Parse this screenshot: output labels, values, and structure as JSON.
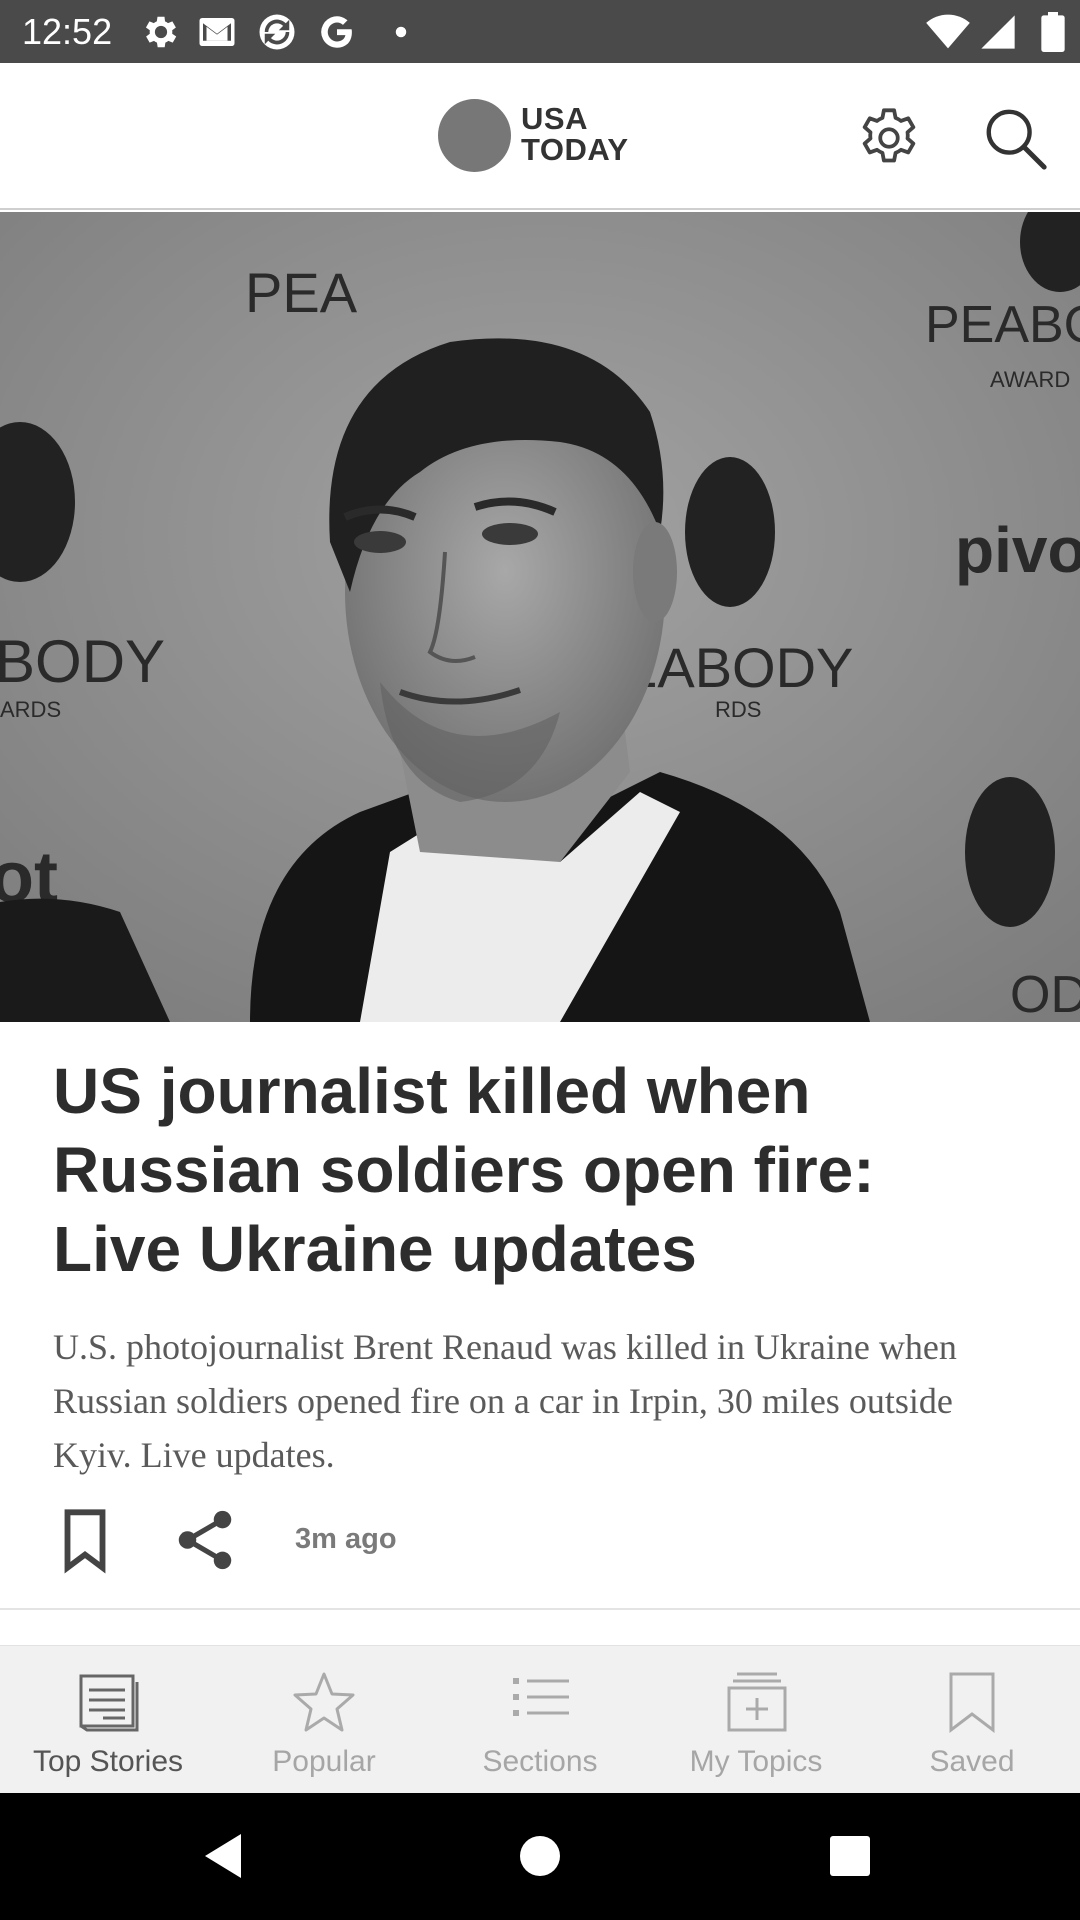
{
  "status_bar": {
    "time": "12:52",
    "left_icons": [
      "settings-icon",
      "gmail-icon",
      "sync-app-icon",
      "google-icon",
      "dot-icon"
    ],
    "right_icons": [
      "wifi-icon",
      "signal-icon",
      "battery-icon"
    ]
  },
  "header": {
    "logo_line1": "USA",
    "logo_line2": "TODAY",
    "logo_color": "#777777",
    "settings_icon": "gear-icon",
    "search_icon": "search-icon"
  },
  "hero": {
    "backdrop_words": [
      "PEA",
      "PEABO",
      "AWARD",
      "pivo",
      "BODY",
      "ARDS",
      "EABODY",
      "RDS",
      "ot",
      "OD"
    ]
  },
  "article": {
    "headline": "US journalist killed when Russian soldiers open fire: Live Ukraine updates",
    "summary": "U.S. photojournalist Brent Renaud was killed in Ukraine when Russian soldiers opened fire on a car in Irpin, 30 miles outside Kyiv. Live updates.",
    "timestamp": "3m ago",
    "save_icon": "bookmark-icon",
    "share_icon": "share-icon"
  },
  "bottom_nav": {
    "items": [
      {
        "label": "Top Stories",
        "icon": "top-stories-icon",
        "active": true
      },
      {
        "label": "Popular",
        "icon": "star-icon",
        "active": false
      },
      {
        "label": "Sections",
        "icon": "list-icon",
        "active": false
      },
      {
        "label": "My Topics",
        "icon": "add-topic-icon",
        "active": false
      },
      {
        "label": "Saved",
        "icon": "bookmark-icon",
        "active": false
      }
    ]
  },
  "system_nav": {
    "back_icon": "back-icon",
    "home_icon": "home-icon",
    "recents_icon": "recents-icon"
  }
}
